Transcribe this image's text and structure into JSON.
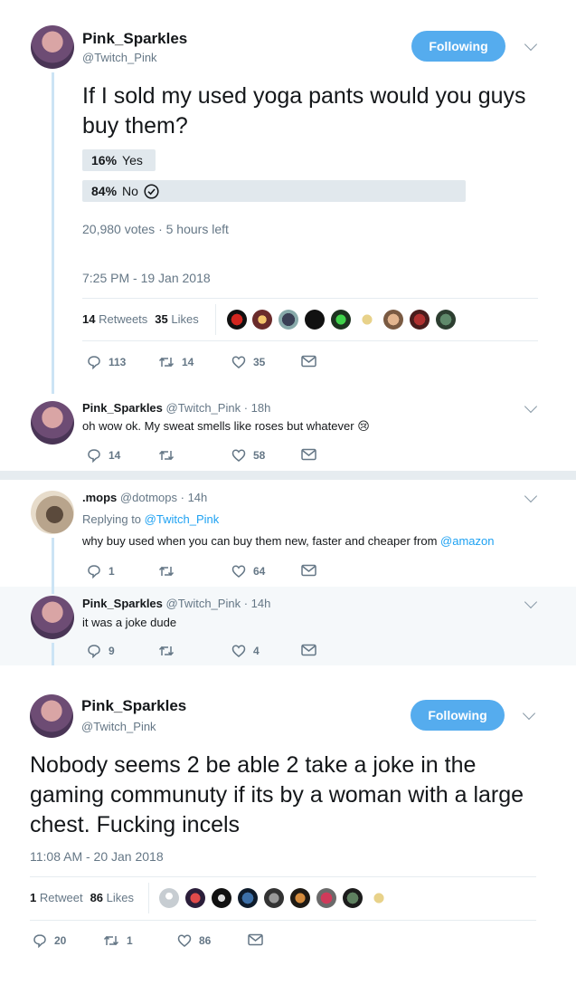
{
  "tweet1": {
    "name": "Pink_Sparkles",
    "handle": "@Twitch_Pink",
    "follow_label": "Following",
    "text": "If I sold my used yoga pants would you guys buy them?",
    "poll": [
      {
        "percent": "16%",
        "label": "Yes",
        "fraction": 0.16,
        "winner": false
      },
      {
        "percent": "84%",
        "label": "No",
        "fraction": 0.84,
        "winner": true
      }
    ],
    "votes": "20,980 votes",
    "time_left": "5 hours left",
    "timestamp": "7:25 PM - 19 Jan 2018",
    "retweets_count": "14",
    "retweets_label": "Retweets",
    "likes_count": "35",
    "likes_label": "Likes",
    "actions": {
      "reply": "113",
      "retweet": "14",
      "like": "35"
    }
  },
  "reply1": {
    "name": "Pink_Sparkles",
    "handle": "@Twitch_Pink",
    "time": "18h",
    "text": "oh wow ok. My sweat smells like roses but whatever",
    "emoji": "😢",
    "actions": {
      "reply": "14",
      "retweet": "",
      "like": "58"
    }
  },
  "reply2": {
    "name": ".mops",
    "handle": "@dotmops",
    "time": "14h",
    "replying_prefix": "Replying to",
    "replying_to": "@Twitch_Pink",
    "text": "why buy used when you can buy them new, faster and cheaper from",
    "mention": "@amazon",
    "actions": {
      "reply": "1",
      "retweet": "",
      "like": "64"
    }
  },
  "reply3": {
    "name": "Pink_Sparkles",
    "handle": "@Twitch_Pink",
    "time": "14h",
    "text": "it was a joke dude",
    "actions": {
      "reply": "9",
      "retweet": "",
      "like": "4"
    }
  },
  "tweet2": {
    "name": "Pink_Sparkles",
    "handle": "@Twitch_Pink",
    "follow_label": "Following",
    "text": "Nobody seems 2 be able 2 take a joke in the gaming communuty if its by a woman with a large chest. Fucking incels",
    "timestamp": "11:08 AM - 20 Jan 2018",
    "retweets_count": "1",
    "retweets_label": "Retweet",
    "likes_count": "86",
    "likes_label": "Likes",
    "actions": {
      "reply": "20",
      "retweet": "1",
      "like": "86"
    }
  },
  "colors": {
    "accent": "#55acee",
    "link": "#1da1f2",
    "thread_line": "#cce4f5",
    "poll_bar": "#e1e8ed",
    "muted": "#657786"
  }
}
